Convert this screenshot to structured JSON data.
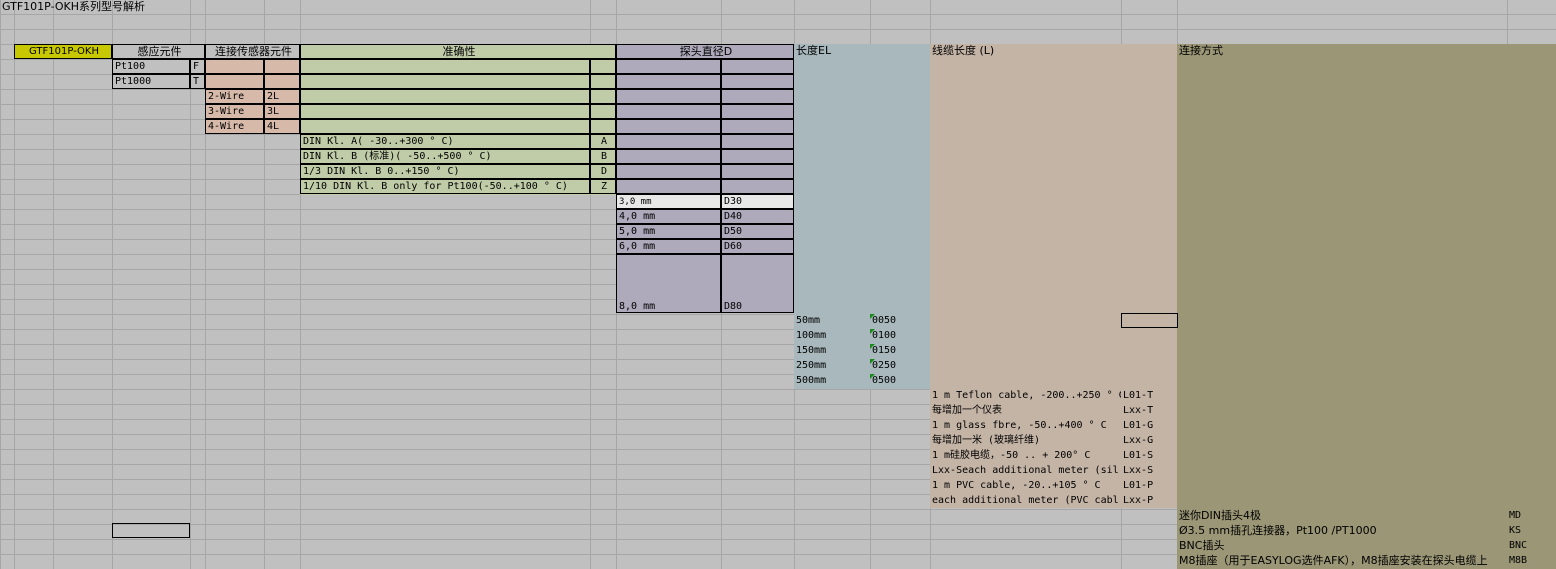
{
  "title": "GTF101P-OKH系列型号解析",
  "colors": {
    "model_bg": "#c8c800",
    "sensor_bg": "#c0c0c0",
    "wire_bg": "#d6b9a9",
    "accuracy_bg": "#c0cca8",
    "diameter_bg": "#aeaabb",
    "length_bg": "#a8b8bc",
    "cable_bg": "#c4b4a6",
    "connection_bg": "#9a9676"
  },
  "headers": {
    "model": "GTF101P-OKH",
    "sensor": "感应元件",
    "wire": "连接传感器元件",
    "accuracy": "准确性",
    "diameter": "探头直径D",
    "length": "长度EL",
    "cable": "线缆长度 (L)",
    "connection": "连接方式"
  },
  "sensors": [
    {
      "name": "Pt100",
      "code": "F"
    },
    {
      "name": "Pt1000",
      "code": "T"
    }
  ],
  "wires": [
    {
      "name": "2-Wire",
      "code": "2L"
    },
    {
      "name": "3-Wire",
      "code": "3L"
    },
    {
      "name": "4-Wire",
      "code": "4L"
    }
  ],
  "accuracy": [
    {
      "name": "DIN Kl. A( -30..+300 ° C)",
      "code": "A"
    },
    {
      "name": "DIN Kl. B (标准)( -50..+500 ° C)",
      "code": "B"
    },
    {
      "name": "1/3 DIN Kl. B 0..+150 ° C)",
      "code": "D"
    },
    {
      "name": "1/10 DIN Kl. B only for Pt100(-50..+100 ° C)",
      "code": "Z"
    }
  ],
  "diameters": [
    {
      "name": "3,0 mm",
      "code": "D30"
    },
    {
      "name": "4,0 mm",
      "code": "D40"
    },
    {
      "name": "5,0 mm",
      "code": "D50"
    },
    {
      "name": "6,0 mm",
      "code": "D60"
    },
    {
      "name": "8,0 mm",
      "code": "D80"
    }
  ],
  "lengths": [
    {
      "name": "50mm",
      "code": "0050"
    },
    {
      "name": "100mm",
      "code": "0100"
    },
    {
      "name": "150mm",
      "code": "0150"
    },
    {
      "name": "250mm",
      "code": "0250"
    },
    {
      "name": "500mm",
      "code": "0500"
    }
  ],
  "cables": [
    {
      "name": "1 m Teflon cable, -200..+250 ° C",
      "code": "L01-T"
    },
    {
      "name": "每增加一个仪表",
      "code": "Lxx-T"
    },
    {
      "name": "1 m glass fbre, -50..+400 ° C",
      "code": "L01-G"
    },
    {
      "name": "每增加一米 (玻璃纤维)",
      "code": "Lxx-G"
    },
    {
      "name": "1 m硅胶电缆，-50 .. + 200° C",
      "code": "L01-S"
    },
    {
      "name": "Lxx-Seach additional meter (sil",
      "code": "Lxx-S"
    },
    {
      "name": "1 m PVC cable, -20..+105 ° C",
      "code": "L01-P"
    },
    {
      "name": "each additional meter (PVC cabl",
      "code": "Lxx-P"
    }
  ],
  "connections": [
    {
      "name": "迷你DIN插头4极",
      "code": "MD"
    },
    {
      "name": "Ø3.5 mm插孔连接器，Pt100 /PT1000",
      "code": "KS"
    },
    {
      "name": "BNC插头",
      "code": "BNC"
    },
    {
      "name": "M8插座（用于EASYLOG选件AFK），M8插座安装在探头电缆上",
      "code": "M8B"
    }
  ]
}
